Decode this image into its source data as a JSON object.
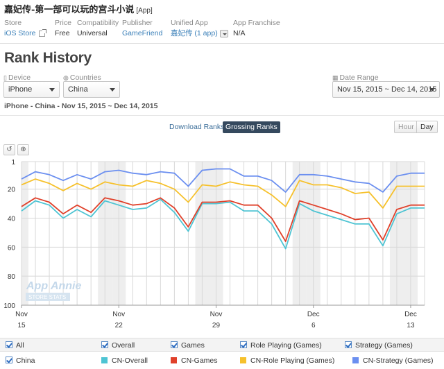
{
  "app": {
    "title": "嘉妃传-第一部可以玩的宫斗小说",
    "tag": "[App]"
  },
  "meta": {
    "store_label": "Store",
    "store_value": "iOS Store",
    "price_label": "Price",
    "price_value": "Free",
    "compat_label": "Compatibility",
    "compat_value": "Universal",
    "publisher_label": "Publisher",
    "publisher_value": "GameFriend",
    "unified_label": "Unified App",
    "unified_value": "嘉妃传 (1 app)",
    "franchise_label": "App Franchise",
    "franchise_value": "N/A"
  },
  "heading": "Rank History",
  "filters": {
    "device_label": "Device",
    "device_value": "iPhone",
    "countries_label": "Countries",
    "countries_value": "China",
    "date_label": "Date Range",
    "date_value": "Nov 15, 2015 ~ Dec 14, 2015"
  },
  "subtitle": "iPhone - China - Nov 15, 2015 ~ Dec 14, 2015",
  "rank_tabs": {
    "download": "Download Ranks",
    "grossing": "Grossing Ranks"
  },
  "granularity": {
    "hour": "Hour",
    "day": "Day"
  },
  "toolbar": {
    "reset_icon": "reset-icon",
    "zoom_icon": "zoom-icon"
  },
  "watermark": {
    "line1": "App Annie",
    "line2": "STORE STATS"
  },
  "chart_data": {
    "type": "line",
    "y_reversed": true,
    "ylim": [
      1,
      100
    ],
    "yticks": [
      "1",
      "20",
      "40",
      "60",
      "80",
      "100"
    ],
    "x_dates": [
      "Nov 15",
      "Nov 16",
      "Nov 17",
      "Nov 18",
      "Nov 19",
      "Nov 20",
      "Nov 21",
      "Nov 22",
      "Nov 23",
      "Nov 24",
      "Nov 25",
      "Nov 26",
      "Nov 27",
      "Nov 28",
      "Nov 29",
      "Nov 30",
      "Dec 1",
      "Dec 2",
      "Dec 3",
      "Dec 4",
      "Dec 5",
      "Dec 6",
      "Dec 7",
      "Dec 8",
      "Dec 9",
      "Dec 10",
      "Dec 11",
      "Dec 12",
      "Dec 13",
      "Dec 14"
    ],
    "xticks": [
      {
        "month": "Nov",
        "day": "15",
        "index": 0
      },
      {
        "month": "Nov",
        "day": "22",
        "index": 7
      },
      {
        "month": "Nov",
        "day": "29",
        "index": 14
      },
      {
        "month": "Dec",
        "day": "6",
        "index": 21
      },
      {
        "month": "Dec",
        "day": "13",
        "index": 28
      }
    ],
    "grid": true,
    "weekend_shading": true,
    "series": [
      {
        "name": "CN-Overall",
        "color": "#4ec4d3",
        "values": [
          35,
          28,
          31,
          40,
          34,
          39,
          28,
          31,
          34,
          33,
          27,
          36,
          49,
          30,
          30,
          29,
          35,
          35,
          44,
          61,
          30,
          35,
          38,
          41,
          44,
          44,
          59,
          37,
          33,
          33
        ]
      },
      {
        "name": "CN-Games",
        "color": "#e0402a",
        "values": [
          32,
          26,
          29,
          37,
          31,
          36,
          26,
          28,
          31,
          30,
          26,
          33,
          46,
          29,
          29,
          28,
          31,
          31,
          40,
          56,
          28,
          31,
          34,
          37,
          41,
          40,
          55,
          34,
          31,
          31
        ]
      },
      {
        "name": "CN-Role Playing (Games)",
        "color": "#f6c12c",
        "values": [
          17,
          13,
          16,
          21,
          16,
          20,
          15,
          17,
          18,
          14,
          16,
          20,
          29,
          17,
          18,
          15,
          17,
          18,
          24,
          32,
          14,
          17,
          17,
          19,
          23,
          22,
          33,
          18,
          18,
          18
        ]
      },
      {
        "name": "CN-Strategy (Games)",
        "color": "#6b8ff0",
        "values": [
          13,
          8,
          10,
          14,
          10,
          13,
          8,
          7,
          9,
          10,
          8,
          9,
          18,
          7,
          6,
          6,
          11,
          11,
          14,
          22,
          10,
          10,
          11,
          13,
          15,
          16,
          22,
          11,
          9,
          9
        ]
      }
    ]
  },
  "legend": {
    "all_label": "All",
    "categories": [
      "Overall",
      "Games",
      "Role Playing (Games)",
      "Strategy (Games)"
    ],
    "country": "China",
    "series_labels": [
      "CN-Overall",
      "CN-Games",
      "CN-Role Playing (Games)",
      "CN-Strategy (Games)"
    ]
  }
}
